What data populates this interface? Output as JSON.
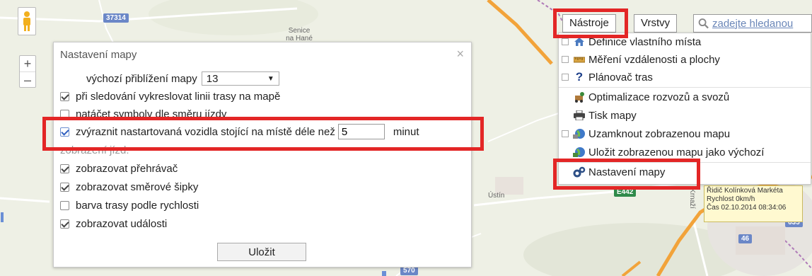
{
  "map": {
    "place_senice": "Senice\nna Hané",
    "place_ustin": "Ústín",
    "road_labels": [
      "37314",
      "E442",
      "635",
      "46",
      "570"
    ],
    "side_label": "Krnaží"
  },
  "controls": {
    "zoom_in": "+",
    "zoom_out": "–"
  },
  "dialog": {
    "title": "Nastavení mapy",
    "close": "×",
    "zoom_label": "výchozí přiblížení mapy",
    "zoom_value": "13",
    "opt_track_line": "při sledování vykreslovat linii trasy na mapě",
    "opt_rotate_symbols": "natáčet symboly dle směru jízdy",
    "opt_highlight_prefix": "zvýraznit nastartovaná vozidla stojící na místě déle než",
    "opt_highlight_value": "5",
    "opt_highlight_unit": "minut",
    "opt_rides_display": "zobrazení jízd:",
    "opt_player": "zobrazovat přehrávač",
    "opt_arrows": "zobrazovat směrové šipky",
    "opt_speed_color": "barva trasy podle rychlosti",
    "opt_events": "zobrazovat události",
    "save": "Uložit"
  },
  "toolbar": {
    "tools": "Nástroje",
    "layers": "Vrstvy",
    "search_placeholder": "zadejte hledanou"
  },
  "menu": {
    "items": [
      {
        "label": "Definice vlastního místa",
        "icon": "house-icon"
      },
      {
        "label": "Měření vzdálenosti a plochy",
        "icon": "ruler-icon"
      },
      {
        "label": "Plánovač tras",
        "icon": "question-icon"
      },
      {
        "label": "Optimalizace rozvozů a svozů",
        "icon": "optimize-icon"
      },
      {
        "label": "Tisk mapy",
        "icon": "printer-icon"
      },
      {
        "label": "Uzamknout zobrazenou mapu",
        "icon": "globe-lock-icon"
      },
      {
        "label": "Uložit zobrazenou mapu jako výchozí",
        "icon": "globe-save-icon"
      },
      {
        "label": "Nastavení mapy",
        "icon": "gears-icon"
      }
    ]
  },
  "info": {
    "line1": "Řidič Kolínková Markéta",
    "line2": "Rychlost 0km/h",
    "line3": "Čas 02.10.2014 08:34:06"
  },
  "colors": {
    "highlight": "#e32626",
    "road_orange": "#f2a33a",
    "link_blue": "#6a86b8"
  }
}
